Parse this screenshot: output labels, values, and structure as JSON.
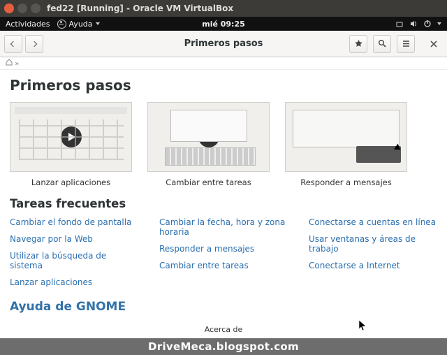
{
  "vbox": {
    "title": "fed22 [Running] - Oracle VM VirtualBox"
  },
  "gnometop": {
    "activities": "Actividades",
    "help_menu": "Ayuda",
    "clock": "mié 09:25"
  },
  "header": {
    "title": "Primeros pasos"
  },
  "breadcrumb": {
    "sep": "»"
  },
  "page": {
    "h1": "Primeros pasos",
    "cards": [
      {
        "caption": "Lanzar aplicaciones"
      },
      {
        "caption": "Cambiar entre tareas"
      },
      {
        "caption": "Responder a mensajes"
      }
    ],
    "h2": "Tareas frecuentes",
    "columns": [
      [
        "Cambiar el fondo de pantalla",
        "Navegar por la Web",
        "Utilizar la búsqueda de sistema",
        "Lanzar aplicaciones"
      ],
      [
        "Cambiar la fecha, hora y zona horaria",
        "Responder a mensajes",
        "Cambiar entre tareas"
      ],
      [
        "Conectarse a cuentas en línea",
        "Usar ventanas y áreas de trabajo",
        "Conectarse a Internet"
      ]
    ],
    "gnome_help": "Ayuda de GNOME",
    "about": "Acerca de"
  },
  "watermark": "DriveMeca.blogspot.com"
}
